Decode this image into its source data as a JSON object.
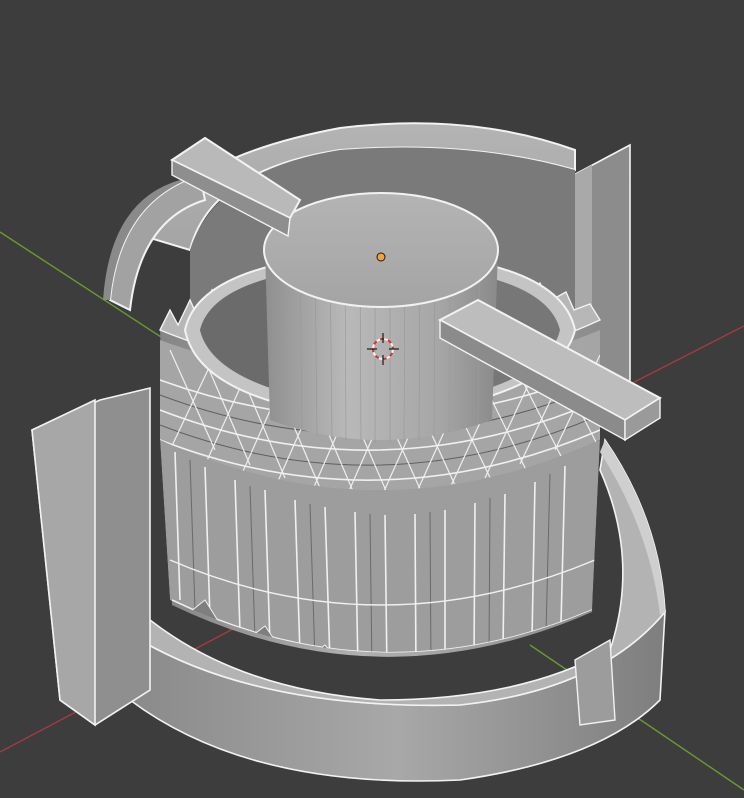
{
  "viewport": {
    "background_color": "#3d3d3d",
    "axis_x_color": "#a33a44",
    "axis_y_color": "#6a9a2e"
  },
  "model": {
    "surface_color": "#a9a9a9",
    "edge_highlight": "#f2f2f2",
    "shadow_color": "#6e6e6e"
  },
  "origin_marker": {
    "icon": "object-origin-icon",
    "color": "#f2a23a"
  },
  "cursor": {
    "icon": "3d-cursor-icon",
    "ring_colors": [
      "#d8302a",
      "#f2f2f2"
    ]
  }
}
